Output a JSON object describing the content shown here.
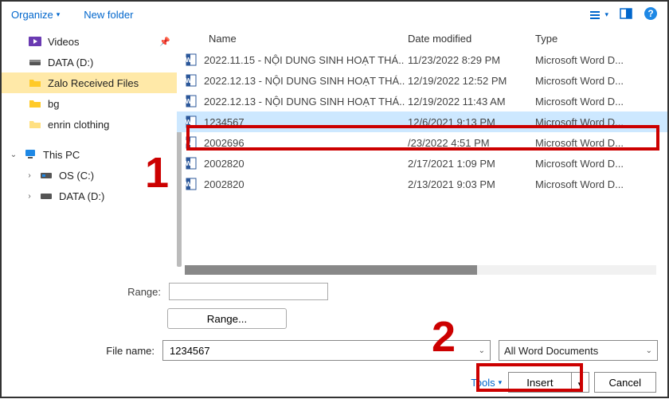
{
  "toolbar": {
    "organize": "Organize",
    "newfolder": "New folder"
  },
  "sidebar": {
    "groups": {
      "quick": [
        {
          "icon": "video",
          "label": "Videos",
          "pinned": true
        },
        {
          "icon": "drive",
          "label": "DATA (D:)"
        },
        {
          "icon": "folder-open",
          "label": "Zalo Received Files",
          "selected": true
        },
        {
          "icon": "folder",
          "label": "bg"
        },
        {
          "icon": "folder",
          "label": "enrin clothing"
        }
      ],
      "thispc": {
        "label": "This PC"
      },
      "drives": [
        {
          "label": "OS (C:)"
        },
        {
          "label": "DATA (D:)"
        }
      ]
    }
  },
  "list": {
    "columns": {
      "name": "Name",
      "date": "Date modified",
      "type": "Type"
    },
    "rows": [
      {
        "name": "2022.11.15 - NỘI DUNG SINH HOẠT THÁ..",
        "date": "11/23/2022 8:29 PM",
        "type": "Microsoft Word D..."
      },
      {
        "name": "2022.12.13 - NỘI DUNG SINH HOẠT THÁ..",
        "date": "12/19/2022 12:52 PM",
        "type": "Microsoft Word D..."
      },
      {
        "name": "2022.12.13 - NỘI DUNG SINH HOẠT THÁ..",
        "date": "12/19/2022 11:43 AM",
        "type": "Microsoft Word D..."
      },
      {
        "name": "1234567",
        "date": "12/6/2021 9:13 PM",
        "type": "Microsoft Word D...",
        "selected": true
      },
      {
        "name": "2002696_",
        "date": "/23/2022 4:51 PM",
        "type": "Microsoft Word D..."
      },
      {
        "name": "2002820",
        "date": "2/17/2021 1:09 PM",
        "type": "Microsoft Word D..."
      },
      {
        "name": "2002820",
        "date": "2/13/2021 9:03 PM",
        "type": "Microsoft Word D..."
      }
    ]
  },
  "range": {
    "label": "Range:",
    "value": "",
    "button": "Range..."
  },
  "filename": {
    "label": "File name:",
    "value": "1234567",
    "filter": "All Word Documents"
  },
  "actions": {
    "tools": "Tools",
    "insert": "Insert",
    "cancel": "Cancel"
  },
  "annotations": {
    "n1": "1",
    "n2": "2"
  }
}
